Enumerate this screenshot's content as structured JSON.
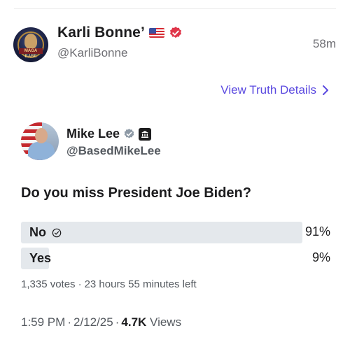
{
  "author": {
    "name": "Karli Bonne’",
    "handle": "@KarliBonne",
    "time": "58m",
    "avatar_text": "MAGA BABE"
  },
  "view_details_label": "View Truth Details",
  "quoted": {
    "name": "Mike Lee",
    "handle": "@BasedMikeLee",
    "question": "Do you miss President Joe Biden?",
    "poll": {
      "options": [
        {
          "label": "No",
          "percent": "91%",
          "fraction": 0.91,
          "selected": true
        },
        {
          "label": "Yes",
          "percent": "9%",
          "fraction": 0.09,
          "selected": false
        }
      ],
      "votes": "1,335 votes",
      "time_left": "23 hours 55 minutes left"
    },
    "posted_time": "1:59 PM",
    "posted_date": "2/12/25",
    "views_count": "4.7K",
    "views_label": "Views"
  },
  "colors": {
    "accent": "#5b4ae0",
    "verified_red": "#e0364a",
    "poll_fill": "#e4e8ec",
    "muted_text": "#6e6e73"
  }
}
